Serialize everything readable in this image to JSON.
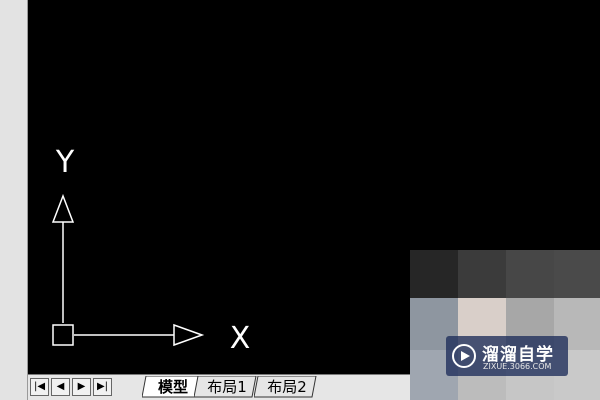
{
  "ucs": {
    "y_label": "Y",
    "x_label": "X",
    "icon": "ucs-icon"
  },
  "tab_nav": [
    {
      "name": "first",
      "glyph": "|◀",
      "icon": "first-tab-icon"
    },
    {
      "name": "prev",
      "glyph": "◀",
      "icon": "prev-tab-icon"
    },
    {
      "name": "next",
      "glyph": "▶",
      "icon": "next-tab-icon"
    },
    {
      "name": "last",
      "glyph": "▶|",
      "icon": "last-tab-icon"
    }
  ],
  "tabs": [
    {
      "label": "模型",
      "active": true
    },
    {
      "label": "布局1",
      "active": false
    },
    {
      "label": "布局2",
      "active": false
    }
  ],
  "watermark": {
    "brand": "溜溜自学",
    "site": "ZIXUE.3066.COM"
  },
  "colors": {
    "canvas": "#000000",
    "ucs_stroke": "#ffffff",
    "tab_bar": "#e6e6e6"
  }
}
